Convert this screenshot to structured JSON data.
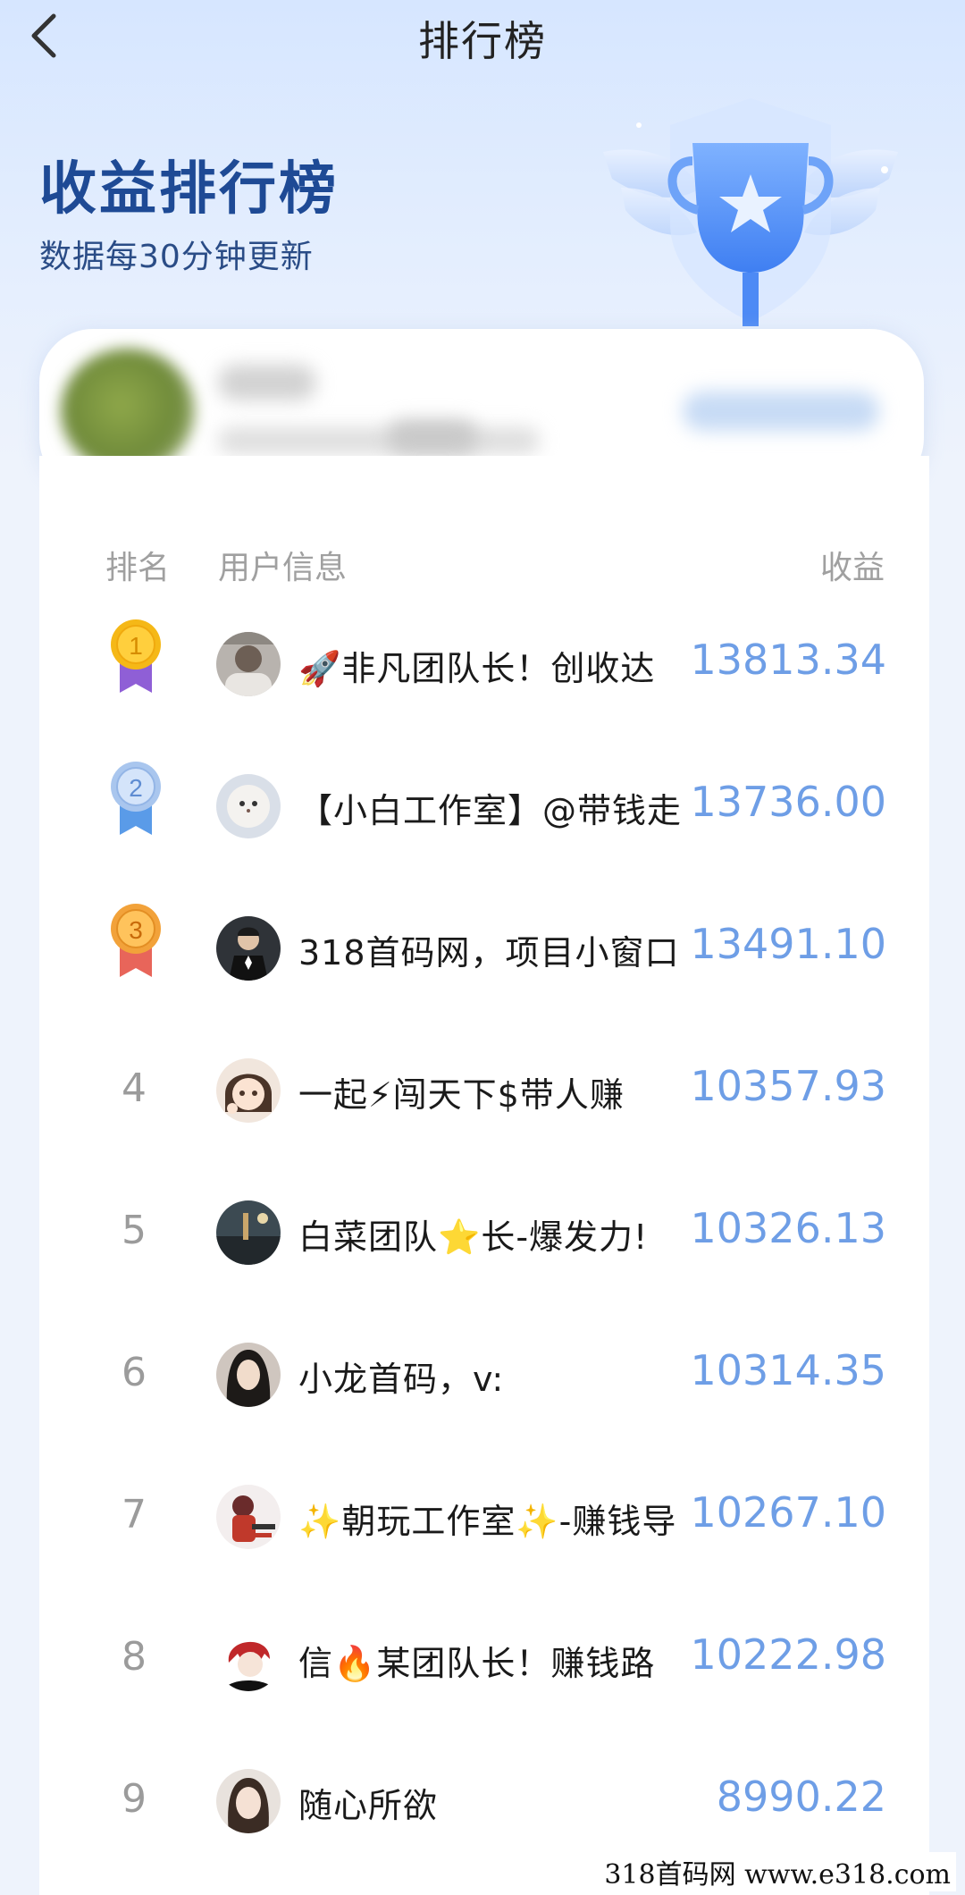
{
  "nav": {
    "title": "排行榜"
  },
  "header": {
    "title": "收益排行榜",
    "subtitle": "数据每30分钟更新"
  },
  "colors": {
    "accent": "#6e9ee6",
    "title": "#1e4a95",
    "gold": "#f5b817",
    "silver": "#a9c6ee",
    "bronze": "#f2a23a",
    "ribbon_purple": "#8f5fd6",
    "ribbon_blue": "#5a9be8",
    "ribbon_red": "#e8655a"
  },
  "columns": {
    "rank": "排名",
    "user": "用户信息",
    "earnings": "收益"
  },
  "rows": [
    {
      "rank": "1",
      "name": "🚀非凡团队长！创收达",
      "earnings": "13813.34",
      "medal": "gold"
    },
    {
      "rank": "2",
      "name": "【小白工作室】@带钱走",
      "earnings": "13736.00",
      "medal": "silver"
    },
    {
      "rank": "3",
      "name": "318首码网，项目小窗口",
      "earnings": "13491.10",
      "medal": "bronze"
    },
    {
      "rank": "4",
      "name": "一起⚡闯天下$带人赚",
      "earnings": "10357.93"
    },
    {
      "rank": "5",
      "name": "白菜团队⭐长-爆发力!",
      "earnings": "10326.13"
    },
    {
      "rank": "6",
      "name": "小龙首码，v:",
      "earnings": "10314.35"
    },
    {
      "rank": "7",
      "name": "✨朝玩工作室✨-赚钱导",
      "earnings": "10267.10"
    },
    {
      "rank": "8",
      "name": "信🔥某团队长！赚钱路",
      "earnings": "10222.98"
    },
    {
      "rank": "9",
      "name": "随心所欲",
      "earnings": "8990.22"
    }
  ],
  "watermark": "318首码网  www.e318.com",
  "icons": {
    "back": "chevron-left-icon",
    "trophy": "trophy-icon"
  }
}
